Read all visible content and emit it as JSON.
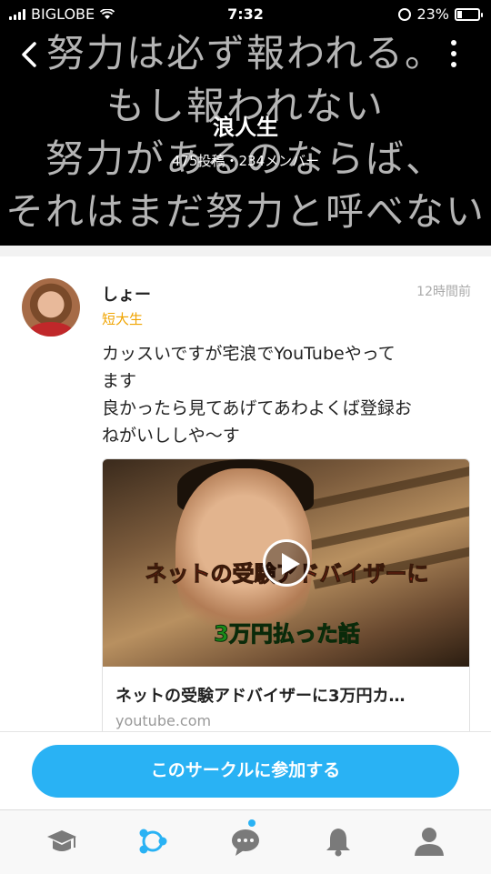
{
  "status_bar": {
    "carrier": "BIGLOBE",
    "time": "7:32",
    "battery": "23%",
    "battery_level": 0.23
  },
  "header": {
    "background_text": [
      "努力は必ず報われる。",
      "もし報われない",
      "努力があるのならば、",
      "それはまだ努力と呼べない"
    ],
    "title": "浪人生",
    "meta": "475投稿・234メンバー"
  },
  "post": {
    "author": "しょー",
    "role": "短大生",
    "time_ago": "12時間前",
    "body_lines": [
      "カッスいですが宅浪でYouTubeやって",
      "ます",
      "良かったら見てあげてあわよくば登録お",
      "ねがいししや〜す"
    ],
    "link": {
      "thumbnail_caption_1": "ネットの受験アドバイザーに",
      "thumbnail_caption_2": "3万円払った話",
      "title": "ネットの受験アドバイザーに3万円カ…",
      "domain": "youtube.com"
    }
  },
  "join_button_label": "このサークルに参加する",
  "tabs": [
    {
      "icon": "graduation-cap-icon"
    },
    {
      "icon": "circles-network-icon",
      "active": true
    },
    {
      "icon": "chat-bubble-icon",
      "badge": true
    },
    {
      "icon": "bell-icon"
    },
    {
      "icon": "profile-icon"
    }
  ],
  "colors": {
    "accent": "#29b2f4",
    "role": "#f0a400",
    "header_bg": "#000000"
  }
}
